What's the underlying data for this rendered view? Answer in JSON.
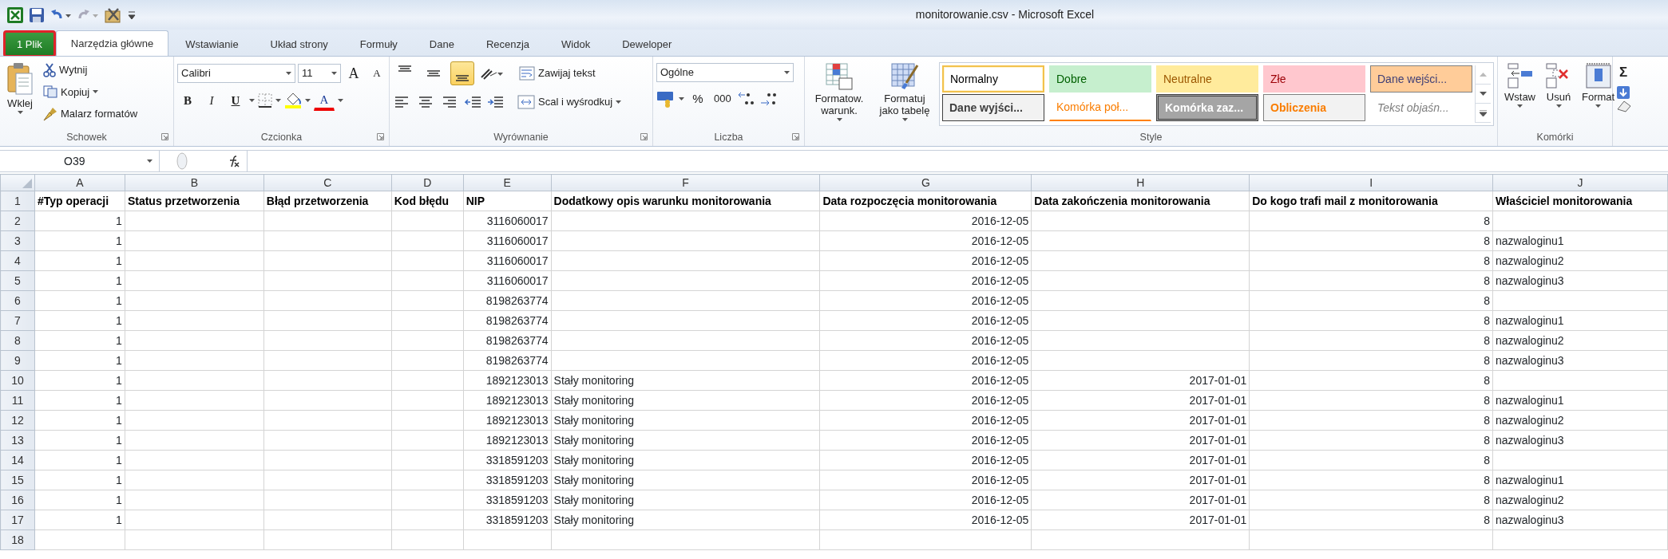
{
  "window": {
    "title": "monitorowanie.csv  -  Microsoft Excel"
  },
  "tabs": [
    {
      "label": "1 Plik",
      "kind": "file",
      "selected": false,
      "outlined": true
    },
    {
      "label": "Narzędzia główne",
      "kind": "tab",
      "selected": true,
      "outlined": false
    },
    {
      "label": "Wstawianie",
      "kind": "tab",
      "selected": false,
      "outlined": false
    },
    {
      "label": "Układ strony",
      "kind": "tab",
      "selected": false,
      "outlined": false
    },
    {
      "label": "Formuły",
      "kind": "tab",
      "selected": false,
      "outlined": false
    },
    {
      "label": "Dane",
      "kind": "tab",
      "selected": false,
      "outlined": false
    },
    {
      "label": "Recenzja",
      "kind": "tab",
      "selected": false,
      "outlined": false
    },
    {
      "label": "Widok",
      "kind": "tab",
      "selected": false,
      "outlined": false
    },
    {
      "label": "Deweloper",
      "kind": "tab",
      "selected": false,
      "outlined": false
    }
  ],
  "clipboard": {
    "label": "Schowek",
    "paste": "Wklej",
    "cut": "Wytnij",
    "copy": "Kopiuj",
    "painter": "Malarz formatów"
  },
  "font": {
    "label": "Czcionka",
    "name": "Calibri",
    "size": "11",
    "grow": "A",
    "shrink": "A",
    "bold": "B",
    "italic": "I",
    "underline": "U",
    "text_color_button": "A"
  },
  "alignment": {
    "label": "Wyrównanie",
    "vertical": [
      {
        "kind": "top",
        "on": false
      },
      {
        "kind": "middle",
        "on": false
      },
      {
        "kind": "bottom",
        "on": true
      }
    ],
    "wrap": "Zawijaj tekst",
    "merge": "Scal i wyśrodkuj"
  },
  "number": {
    "label": "Liczba",
    "format": "Ogólne",
    "percent": "%",
    "thousands": "000"
  },
  "styles": {
    "label": "Style",
    "conditional": "Formatow. warunk.",
    "as_table": "Formatuj jako tabelę",
    "gallery": [
      {
        "label": "Normalny",
        "kind": "normal",
        "selected": true
      },
      {
        "label": "Dobre",
        "kind": "good",
        "selected": false
      },
      {
        "label": "Neutralne",
        "kind": "neutral",
        "selected": false
      },
      {
        "label": "Złe",
        "kind": "bad",
        "selected": false
      },
      {
        "label": "Dane wejści...",
        "kind": "input",
        "selected": false
      },
      {
        "label": "Dane wyjści...",
        "kind": "output",
        "selected": false
      },
      {
        "label": "Komórka poł...",
        "kind": "linked",
        "selected": false
      },
      {
        "label": "Komórka zaz...",
        "kind": "check",
        "selected": false
      },
      {
        "label": "Obliczenia",
        "kind": "calc",
        "selected": false
      },
      {
        "label": "Tekst objaśn...",
        "kind": "note",
        "selected": false
      }
    ]
  },
  "cells_group": {
    "label": "Komórki",
    "buttons": [
      {
        "label": "Wstaw",
        "kind": "insert"
      },
      {
        "label": "Usuń",
        "kind": "delete"
      },
      {
        "label": "Format",
        "kind": "format"
      }
    ]
  },
  "editing": {
    "sum": "Σ"
  },
  "formula_bar": {
    "name_box": "O39"
  },
  "sheet": {
    "columns": [
      {
        "letter": "A",
        "kind": "number"
      },
      {
        "letter": "B",
        "kind": "text"
      },
      {
        "letter": "C",
        "kind": "text"
      },
      {
        "letter": "D",
        "kind": "text"
      },
      {
        "letter": "E",
        "kind": "number"
      },
      {
        "letter": "F",
        "kind": "text"
      },
      {
        "letter": "G",
        "kind": "number"
      },
      {
        "letter": "H",
        "kind": "number"
      },
      {
        "letter": "I",
        "kind": "number"
      },
      {
        "letter": "J",
        "kind": "text"
      }
    ],
    "rows": [
      {
        "number": "1",
        "header": true,
        "cells": {
          "A": "#Typ operacji",
          "B": "Status przetworzenia",
          "C": "Błąd przetworzenia",
          "D": "Kod błędu",
          "E": "NIP",
          "F": "Dodatkowy opis warunku monitorowania",
          "G": "Data rozpoczęcia monitorowania",
          "H": "Data zakończenia monitorowania",
          "I": "Do kogo trafi mail z monitorowania",
          "J": "Właściciel monitorowania"
        }
      },
      {
        "number": "2",
        "header": false,
        "cells": {
          "A": "1",
          "E": "3116060017",
          "G": "2016-12-05",
          "I": "8"
        }
      },
      {
        "number": "3",
        "header": false,
        "cells": {
          "A": "1",
          "E": "3116060017",
          "G": "2016-12-05",
          "I": "8",
          "J": "nazwaloginu1"
        }
      },
      {
        "number": "4",
        "header": false,
        "cells": {
          "A": "1",
          "E": "3116060017",
          "G": "2016-12-05",
          "I": "8",
          "J": "nazwaloginu2"
        }
      },
      {
        "number": "5",
        "header": false,
        "cells": {
          "A": "1",
          "E": "3116060017",
          "G": "2016-12-05",
          "I": "8",
          "J": "nazwaloginu3"
        }
      },
      {
        "number": "6",
        "header": false,
        "cells": {
          "A": "1",
          "E": "8198263774",
          "G": "2016-12-05",
          "I": "8"
        }
      },
      {
        "number": "7",
        "header": false,
        "cells": {
          "A": "1",
          "E": "8198263774",
          "G": "2016-12-05",
          "I": "8",
          "J": "nazwaloginu1"
        }
      },
      {
        "number": "8",
        "header": false,
        "cells": {
          "A": "1",
          "E": "8198263774",
          "G": "2016-12-05",
          "I": "8",
          "J": "nazwaloginu2"
        }
      },
      {
        "number": "9",
        "header": false,
        "cells": {
          "A": "1",
          "E": "8198263774",
          "G": "2016-12-05",
          "I": "8",
          "J": "nazwaloginu3"
        }
      },
      {
        "number": "10",
        "header": false,
        "cells": {
          "A": "1",
          "E": "1892123013",
          "F": "Stały monitoring",
          "G": "2016-12-05",
          "H": "2017-01-01",
          "I": "8"
        }
      },
      {
        "number": "11",
        "header": false,
        "cells": {
          "A": "1",
          "E": "1892123013",
          "F": "Stały monitoring",
          "G": "2016-12-05",
          "H": "2017-01-01",
          "I": "8",
          "J": "nazwaloginu1"
        }
      },
      {
        "number": "12",
        "header": false,
        "cells": {
          "A": "1",
          "E": "1892123013",
          "F": "Stały monitoring",
          "G": "2016-12-05",
          "H": "2017-01-01",
          "I": "8",
          "J": "nazwaloginu2"
        }
      },
      {
        "number": "13",
        "header": false,
        "cells": {
          "A": "1",
          "E": "1892123013",
          "F": "Stały monitoring",
          "G": "2016-12-05",
          "H": "2017-01-01",
          "I": "8",
          "J": "nazwaloginu3"
        }
      },
      {
        "number": "14",
        "header": false,
        "cells": {
          "A": "1",
          "E": "3318591203",
          "F": "Stały monitoring",
          "G": "2016-12-05",
          "H": "2017-01-01",
          "I": "8"
        }
      },
      {
        "number": "15",
        "header": false,
        "cells": {
          "A": "1",
          "E": "3318591203",
          "F": "Stały monitoring",
          "G": "2016-12-05",
          "H": "2017-01-01",
          "I": "8",
          "J": "nazwaloginu1"
        }
      },
      {
        "number": "16",
        "header": false,
        "cells": {
          "A": "1",
          "E": "3318591203",
          "F": "Stały monitoring",
          "G": "2016-12-05",
          "H": "2017-01-01",
          "I": "8",
          "J": "nazwaloginu2"
        }
      },
      {
        "number": "17",
        "header": false,
        "cells": {
          "A": "1",
          "E": "3318591203",
          "F": "Stały monitoring",
          "G": "2016-12-05",
          "H": "2017-01-01",
          "I": "8",
          "J": "nazwaloginu3"
        }
      },
      {
        "number": "18",
        "cells": {}
      }
    ]
  }
}
